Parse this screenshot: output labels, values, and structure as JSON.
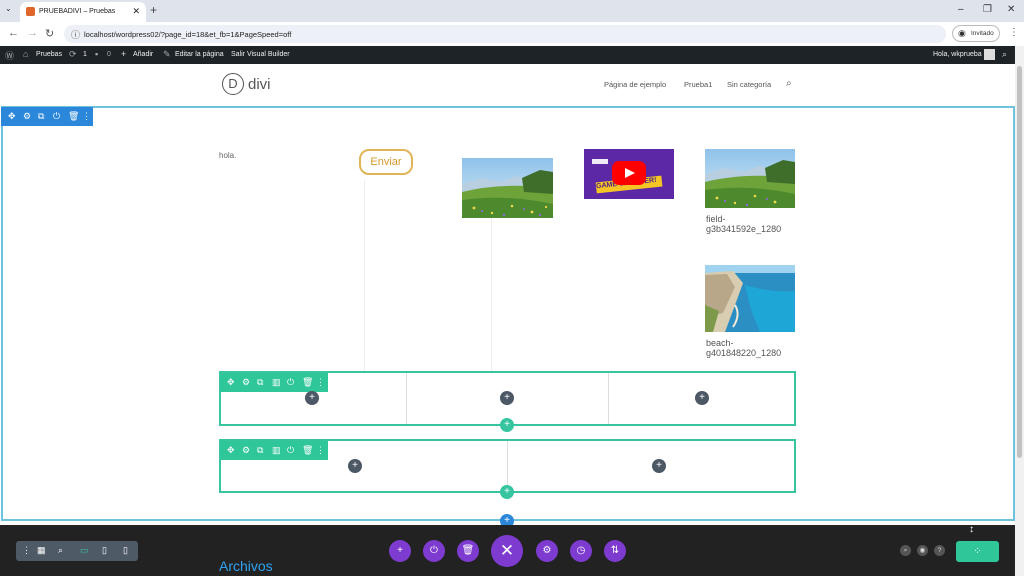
{
  "browser": {
    "tab_title": "PRUEBADIVI – Pruebas",
    "tab_close": "✕",
    "new_tab": "+",
    "url": "localhost/wordpress02/?page_id=18&et_fb=1&PageSpeed=off",
    "profile_label": "Invitado",
    "win_minimize": "–",
    "win_restore": "❐",
    "win_close": "✕"
  },
  "wp_admin_bar": {
    "site_name": "Pruebas",
    "updates_count": "1",
    "comments_count": "0",
    "add_new": "Añadir",
    "edit_page": "Editar la página",
    "exit_builder": "Salir Visual Builder",
    "greeting": "Hola, wkprueba"
  },
  "site": {
    "logo_letter": "D",
    "logo_text": "divi",
    "menu": [
      "Página de ejemplo",
      "Prueba1",
      "Sin categoría"
    ]
  },
  "content": {
    "text_module": "hola.",
    "button_label": "Enviar",
    "video_overlay_text": "GAME CHANGER!",
    "caption_field": "field-\ng3b341592e_1280",
    "caption_beach": "beach-\ng401848220_1280",
    "footer_widget_title": "Archivos"
  },
  "icons": {
    "plus": "+",
    "close": "✕"
  },
  "colors": {
    "section_accent": "#2b87da",
    "row_accent": "#2fc79a",
    "builder_purple": "#7e3bd0",
    "button_border": "#e0b458"
  }
}
